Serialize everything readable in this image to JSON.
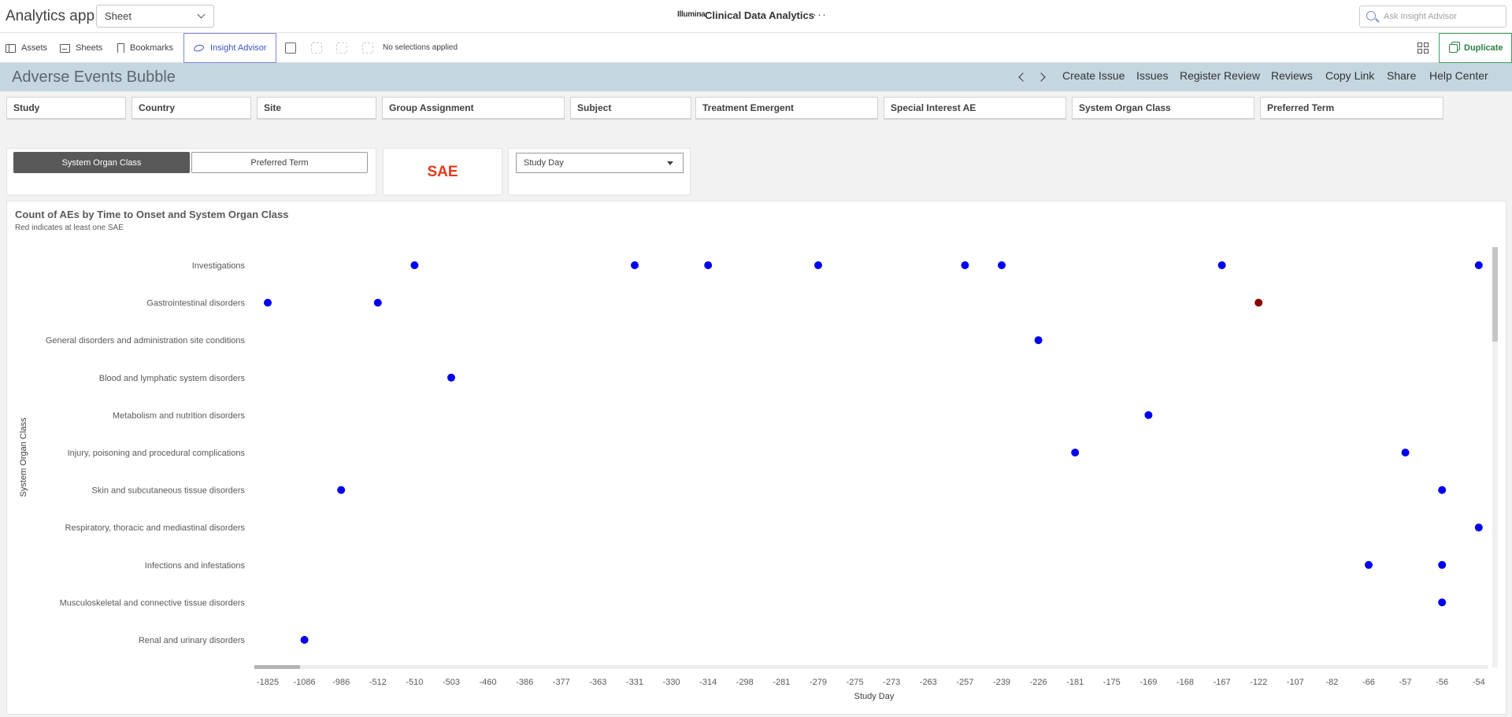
{
  "app": {
    "title": "Analytics app",
    "sheet_select": "Sheet",
    "brand": "Illumina",
    "center_title": "Clinical Data Analytics",
    "more": "···",
    "ask_placeholder": "Ask Insight Advisor"
  },
  "toolbar": {
    "assets": "Assets",
    "sheets": "Sheets",
    "bookmarks": "Bookmarks",
    "insight_advisor": "Insight Advisor",
    "no_selections": "No selections applied",
    "duplicate": "Duplicate"
  },
  "sheet": {
    "title": "Adverse Events Bubble",
    "links": [
      "Create Issue",
      "Issues",
      "Register Review",
      "Reviews",
      "Copy Link",
      "Share",
      "Help Center"
    ]
  },
  "filters": [
    "Study",
    "Country",
    "Site",
    "Group Assignment",
    "Subject",
    "Treatment Emergent",
    "Special Interest AE",
    "System Organ Class",
    "Preferred Term"
  ],
  "controls": {
    "dimension_buttons": [
      "System Organ Class",
      "Preferred Term"
    ],
    "active_dimension": "System Organ Class",
    "sae_label": "SAE",
    "x_select": "Study Day"
  },
  "colors": {
    "non_sae": "#0000ee",
    "sae": "#8b0000",
    "accent": "#3c55c8",
    "duplicate": "#2c7f45",
    "title_bar": "#c5d6e0"
  },
  "chart_data": {
    "type": "scatter",
    "title": "Count of AEs by Time to Onset and System Organ Class",
    "subtitle": "Red indicates at least one SAE",
    "xlabel": "Study Day",
    "ylabel": "System Organ Class",
    "x_categories": [
      "-1825",
      "-1086",
      "-986",
      "-512",
      "-510",
      "-503",
      "-460",
      "-386",
      "-377",
      "-363",
      "-331",
      "-330",
      "-314",
      "-298",
      "-281",
      "-279",
      "-275",
      "-273",
      "-263",
      "-257",
      "-239",
      "-226",
      "-181",
      "-175",
      "-169",
      "-168",
      "-167",
      "-122",
      "-107",
      "-82",
      "-66",
      "-57",
      "-56",
      "-54"
    ],
    "y_categories": [
      "Investigations",
      "Gastrointestinal disorders",
      "General disorders and administration site conditions",
      "Blood and lymphatic system disorders",
      "Metabolism and nutrition disorders",
      "Injury, poisoning and procedural complications",
      "Skin and subcutaneous tissue disorders",
      "Respiratory, thoracic and mediastinal disorders",
      "Infections and infestations",
      "Musculoskeletal and connective tissue disorders",
      "Renal and urinary disorders"
    ],
    "points": [
      {
        "x": "-510",
        "y": "Investigations",
        "sae": false
      },
      {
        "x": "-331",
        "y": "Investigations",
        "sae": false
      },
      {
        "x": "-314",
        "y": "Investigations",
        "sae": false
      },
      {
        "x": "-279",
        "y": "Investigations",
        "sae": false
      },
      {
        "x": "-257",
        "y": "Investigations",
        "sae": false
      },
      {
        "x": "-239",
        "y": "Investigations",
        "sae": false
      },
      {
        "x": "-167",
        "y": "Investigations",
        "sae": false
      },
      {
        "x": "-54",
        "y": "Investigations",
        "sae": false
      },
      {
        "x": "-1825",
        "y": "Gastrointestinal disorders",
        "sae": false
      },
      {
        "x": "-512",
        "y": "Gastrointestinal disorders",
        "sae": false
      },
      {
        "x": "-122",
        "y": "Gastrointestinal disorders",
        "sae": true
      },
      {
        "x": "-226",
        "y": "General disorders and administration site conditions",
        "sae": false
      },
      {
        "x": "-503",
        "y": "Blood and lymphatic system disorders",
        "sae": false
      },
      {
        "x": "-169",
        "y": "Metabolism and nutrition disorders",
        "sae": false
      },
      {
        "x": "-181",
        "y": "Injury, poisoning and procedural complications",
        "sae": false
      },
      {
        "x": "-57",
        "y": "Injury, poisoning and procedural complications",
        "sae": false
      },
      {
        "x": "-986",
        "y": "Skin and subcutaneous tissue disorders",
        "sae": false
      },
      {
        "x": "-56",
        "y": "Skin and subcutaneous tissue disorders",
        "sae": false
      },
      {
        "x": "-54",
        "y": "Respiratory, thoracic and mediastinal disorders",
        "sae": false
      },
      {
        "x": "-66",
        "y": "Infections and infestations",
        "sae": false
      },
      {
        "x": "-56",
        "y": "Infections and infestations",
        "sae": false
      },
      {
        "x": "-56",
        "y": "Musculoskeletal and connective tissue disorders",
        "sae": false
      },
      {
        "x": "-1086",
        "y": "Renal and urinary disorders",
        "sae": false
      }
    ]
  }
}
